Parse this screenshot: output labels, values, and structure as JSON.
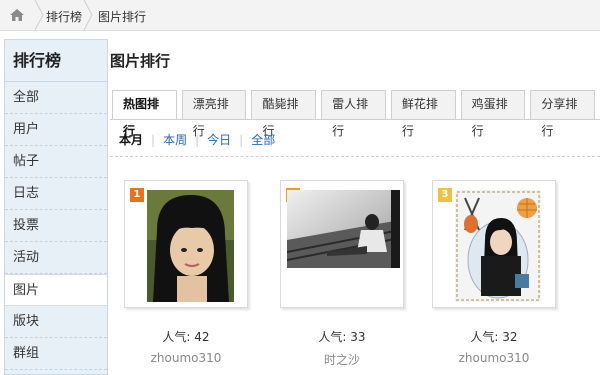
{
  "breadcrumb": {
    "items": [
      "排行榜",
      "图片排行"
    ]
  },
  "sidebar": {
    "title": "排行榜",
    "items": [
      "全部",
      "用户",
      "帖子",
      "日志",
      "投票",
      "活动",
      "图片",
      "版块",
      "群组"
    ],
    "active_index": 6
  },
  "main": {
    "title": "图片排行",
    "tabs": [
      "热图排行",
      "漂亮排行",
      "酷毙排行",
      "雷人排行",
      "鲜花排行",
      "鸡蛋排行",
      "分享排行"
    ],
    "active_tab": 0,
    "periods": [
      "本月",
      "本周",
      "今日",
      "全部"
    ],
    "active_period": 0
  },
  "photos": [
    {
      "rank": "1",
      "popularity": "人气: 42",
      "user": "zhoumo310",
      "rank_color": "#e8731a"
    },
    {
      "rank": "2",
      "popularity": "人气: 33",
      "user": "时之沙",
      "rank_color": "#e8a21a"
    },
    {
      "rank": "3",
      "popularity": "人气: 32",
      "user": "zhoumo310",
      "rank_color": "#f0c040"
    }
  ],
  "colors": {
    "link": "#2266bb",
    "sidebar_bg": "#e8f0f7"
  },
  "icons": {
    "home": "home-icon"
  }
}
